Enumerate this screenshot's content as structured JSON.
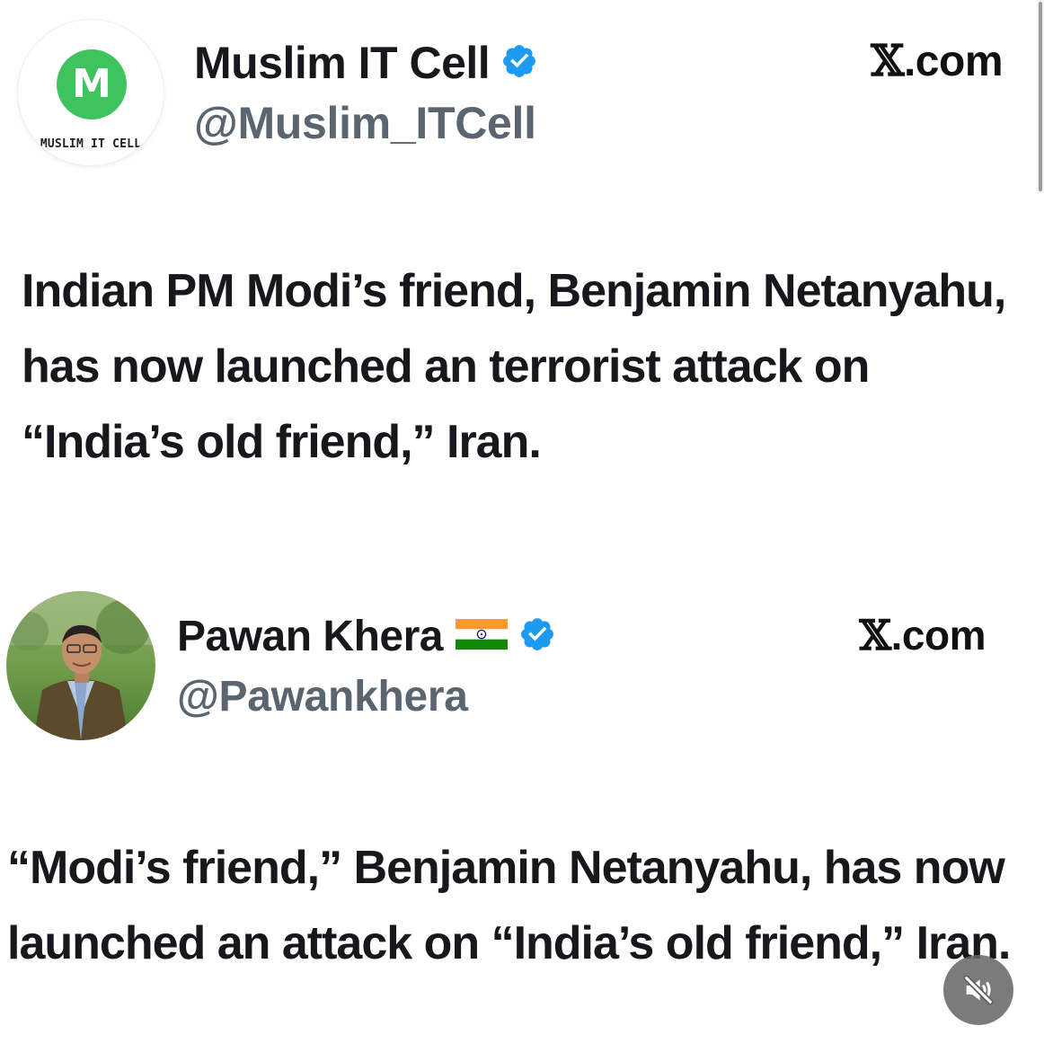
{
  "posts": [
    {
      "avatar": {
        "type": "logo",
        "letter": "M",
        "caption": "MUSLIM IT CELL",
        "color": "#3fc35e"
      },
      "display_name": "Muslim IT Cell",
      "verified": true,
      "handle": "@Muslim_ITCell",
      "site": {
        "x": "𝕏",
        "domain": ".com"
      },
      "text": "Indian PM Modi’s friend, Benjamin Netanyahu, has now launched an terrorist attack on “India’s old friend,” Iran."
    },
    {
      "avatar": {
        "type": "photo"
      },
      "display_name": "Pawan Khera",
      "flag_icon": "india-flag-icon",
      "verified": true,
      "handle": "@Pawankhera",
      "site": {
        "x": "𝕏",
        "domain": ".com"
      },
      "text": "“Modi’s friend,” Benjamin Netanyahu, has now launched an attack on “India’s old friend,” Iran."
    }
  ],
  "colors": {
    "verified_badge": "#1d9bf0",
    "handle": "#5b6570",
    "text": "#16181c"
  },
  "controls": {
    "mute_icon": "muted-speaker-icon"
  }
}
